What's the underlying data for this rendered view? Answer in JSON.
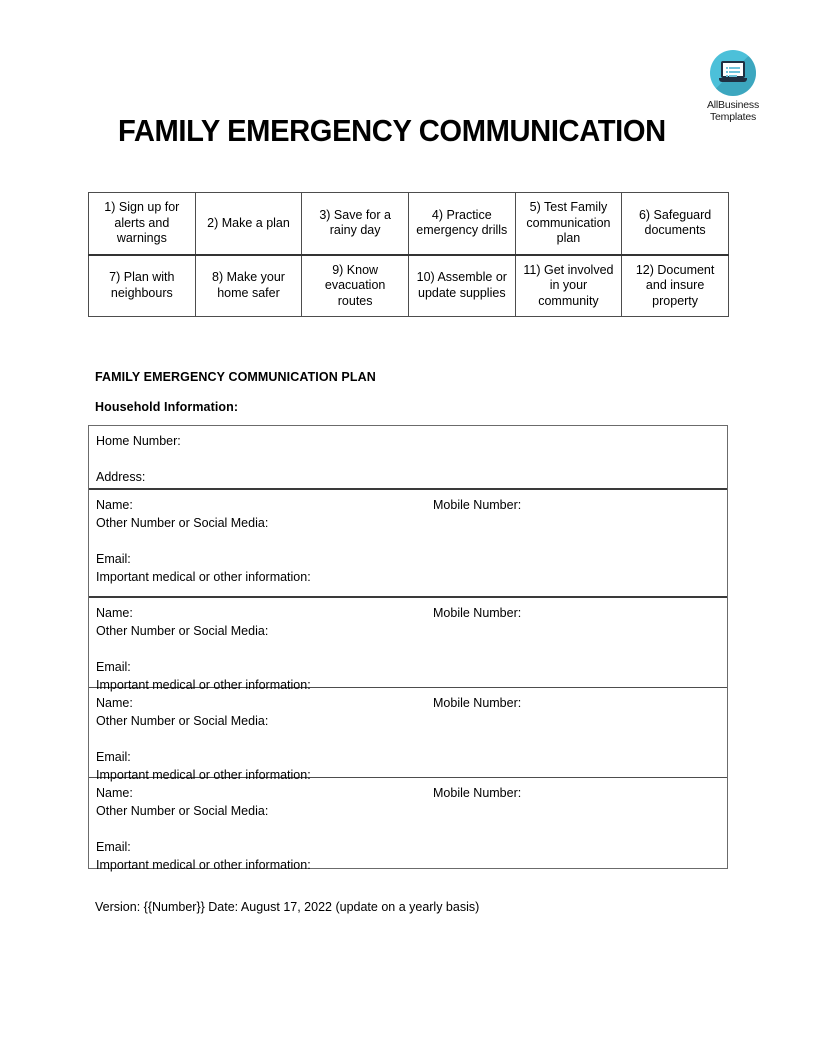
{
  "document": {
    "title": "FAMILY EMERGENCY COMMUNICATION",
    "section_heading": "FAMILY EMERGENCY COMMUNICATION PLAN",
    "subsection_heading": "Household Information:",
    "footer": "Version: {{Number}} Date: August 17, 2022 (update on a yearly basis)"
  },
  "logo": {
    "icon": "laptop-icon",
    "line1": "AllBusiness",
    "line2": "Templates",
    "circle_color": "#4cc0d9",
    "shadow_color": "#176c82",
    "laptop_color": "#1f3042"
  },
  "steps_table": {
    "rows": [
      [
        "1) Sign up for alerts and warnings",
        "2) Make a plan",
        "3) Save for a rainy day",
        "4) Practice emergency drills",
        "5) Test Family communication plan",
        "6) Safeguard documents"
      ],
      [
        "7) Plan with neighbours",
        "8) Make your home safer",
        "9) Know evacuation routes",
        "10) Assemble or update supplies",
        "11) Get involved in your community",
        "12) Document and insure property"
      ]
    ]
  },
  "form": {
    "household": {
      "home_number_label": "Home Number:",
      "address_label": "Address:"
    },
    "person_labels": {
      "name": "Name:",
      "mobile": "Mobile Number:",
      "other": "Other Number or Social Media:",
      "email": "Email:",
      "medical": "Important medical or other information:"
    },
    "people_count": 4
  }
}
